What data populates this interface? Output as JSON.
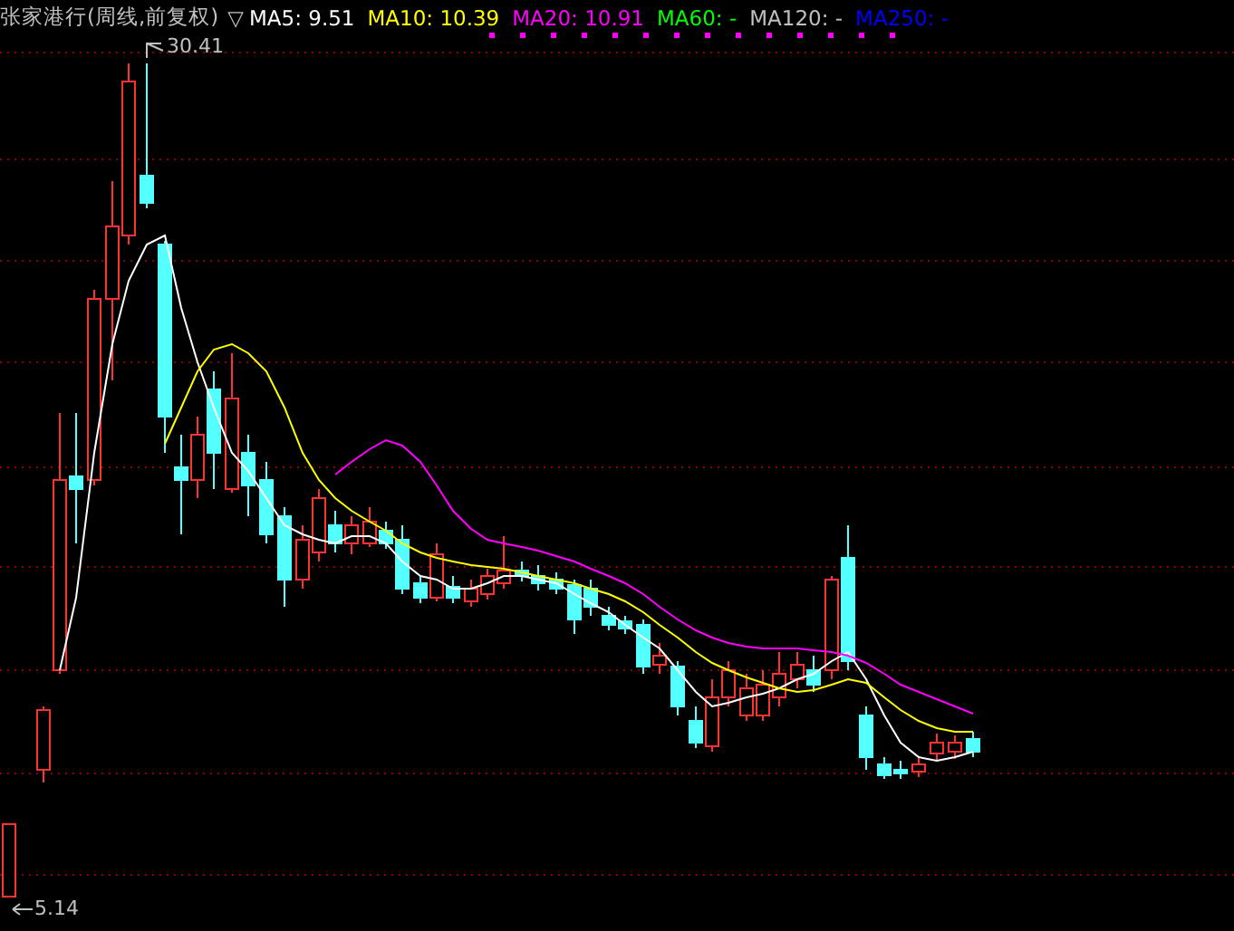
{
  "chart": {
    "title": "张家港行(周线,前复权)",
    "toggle": "▽",
    "indicators": [
      {
        "label": "MA5: 9.51",
        "color": "#ffffff"
      },
      {
        "label": "MA10: 10.39",
        "color": "#ffff00"
      },
      {
        "label": "MA20: 10.91",
        "color": "#ff00ff"
      },
      {
        "label": "MA60: -",
        "color": "#00ff00"
      },
      {
        "label": "MA120: -",
        "color": "#c0c0c0"
      },
      {
        "label": "MA250: -",
        "color": "#0000ff"
      }
    ],
    "high_label": "30.41",
    "low_label": "5.14"
  }
}
